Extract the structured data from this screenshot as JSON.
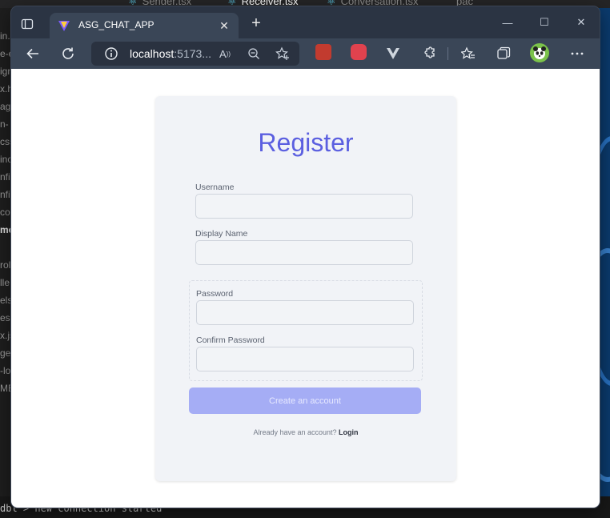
{
  "background": {
    "editor_tabs": [
      "Sender.tsx",
      "Receiver.tsx",
      "Conversation.tsx",
      "pac"
    ],
    "sidebar_fragments": [
      "in.",
      "e-e",
      "ign",
      "x.h",
      "ag",
      "n-",
      "css",
      "inc",
      "nfi",
      "nfi",
      "con",
      "mc",
      "rol",
      "lle",
      "els",
      "es",
      "x.js",
      "ge",
      "-lo",
      "ME"
    ],
    "terminal_lines": [
      "dbl > new connection started"
    ]
  },
  "browser": {
    "tab_title": "ASG_CHAT_APP",
    "url_host": "localhost",
    "url_rest": ":5173...",
    "window_controls": {
      "minimize": "—",
      "maximize": "☐",
      "close": "✕"
    }
  },
  "form": {
    "title": "Register",
    "username_label": "Username",
    "username_value": "",
    "display_name_label": "Display Name",
    "display_name_value": "",
    "password_label": "Password",
    "password_value": "",
    "confirm_password_label": "Confirm Password",
    "confirm_password_value": "",
    "submit_label": "Create an account",
    "login_prompt": "Already have an account?",
    "login_link": "Login"
  },
  "colors": {
    "accent": "#5b5fe0",
    "button": "#a5adf5",
    "card": "#f1f3f7",
    "browser_chrome": "#2b3443",
    "toolbar": "#3a4657"
  }
}
